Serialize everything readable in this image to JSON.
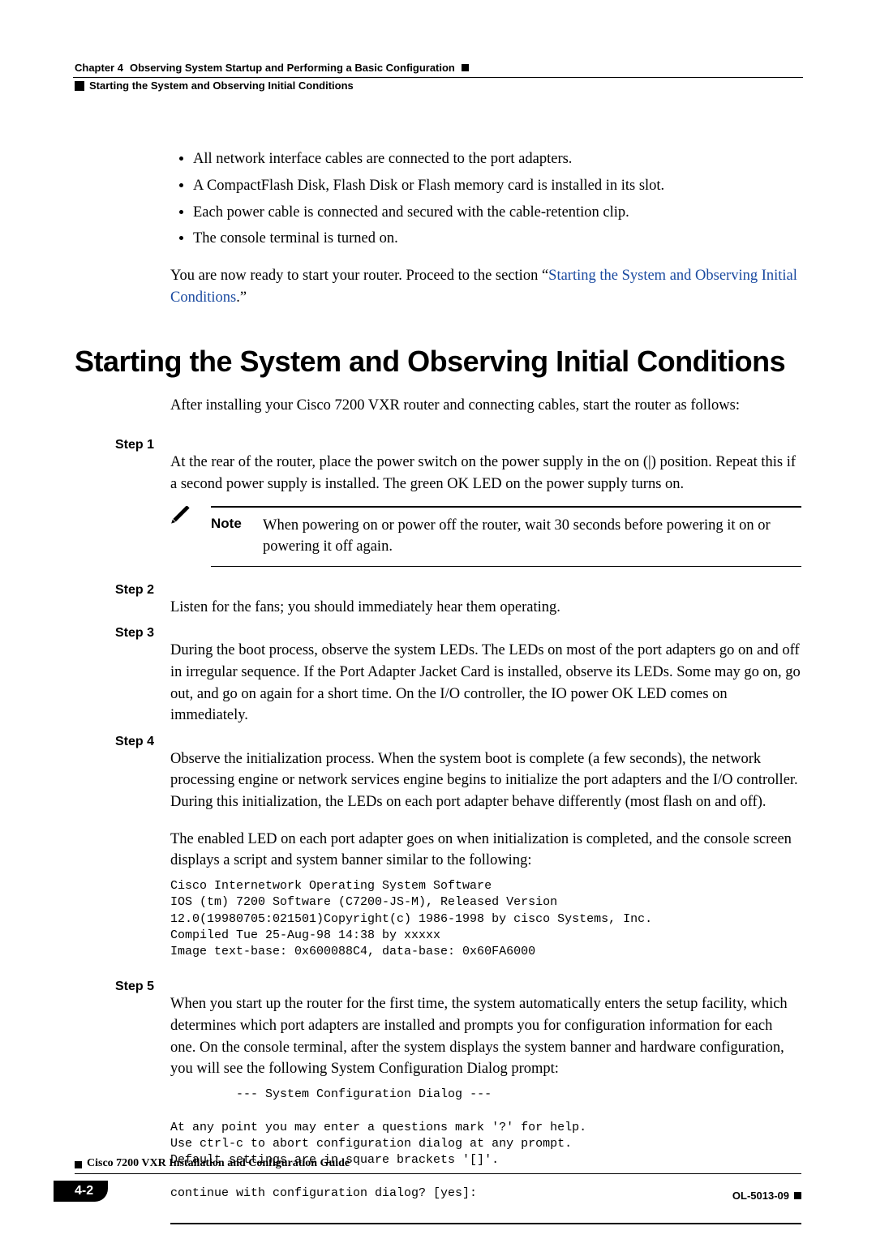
{
  "header": {
    "section_title": "Starting the System and Observing Initial Conditions",
    "chapter_label": "Chapter 4",
    "chapter_title": "Observing System Startup and Performing a Basic Configuration"
  },
  "intro": {
    "bullets": [
      "All network interface cables are connected to the port adapters.",
      "A CompactFlash Disk, Flash Disk or Flash memory card is installed in its slot.",
      "Each power cable is connected and secured with the cable-retention clip.",
      "The console terminal is turned on."
    ],
    "lead_text": "You are now ready to start your router. Proceed to the section “",
    "lead_link": "Starting the System and Observing Initial Conditions",
    "lead_tail": ".”"
  },
  "section": {
    "title": "Starting the System and Observing Initial Conditions",
    "intro": "After installing your Cisco 7200 VXR router and connecting cables, start the router as follows:"
  },
  "steps": {
    "s1_label": "Step 1",
    "s1_text": "At the rear of the router, place the power switch on the power supply in the on (|) position. Repeat this if a second power supply is installed. The green OK LED on the power supply turns on.",
    "note_label": "Note",
    "note_text": "When powering on or power off the router, wait 30 seconds before powering it on or powering it off again.",
    "s2_label": "Step 2",
    "s2_text": "Listen for the fans; you should immediately hear them operating.",
    "s3_label": "Step 3",
    "s3_text": "During the boot process, observe the system LEDs. The LEDs on most of the port adapters go on and off in irregular sequence. If the Port Adapter Jacket Card is installed, observe its LEDs. Some may go on, go out, and go on again for a short time. On the I/O controller, the IO power OK LED comes on immediately.",
    "s4_label": "Step 4",
    "s4_text1": "Observe the initialization process. When the system boot is complete (a few seconds), the network processing engine or network services engine begins to initialize the port adapters and the I/O controller. During this initialization, the LEDs on each port adapter behave differently (most flash on and off).",
    "s4_text2": "The enabled LED on each port adapter goes on when initialization is completed, and the console screen displays a script and system banner similar to the following:",
    "s4_code": "Cisco Internetwork Operating System Software\nIOS (tm) 7200 Software (C7200-JS-M), Released Version 12.0(19980705:021501)Copyright(c) 1986-1998 by cisco Systems, Inc.\nCompiled Tue 25-Aug-98 14:38 by xxxxx\nImage text-base: 0x600088C4, data-base: 0x60FA6000",
    "s5_label": "Step 5",
    "s5_text": "When you start up the router for the first time, the system automatically enters the setup facility, which determines which port adapters are installed and prompts you for configuration information for each one. On the console terminal, after the system displays the system banner and hardware configuration, you will see the following System Configuration Dialog prompt:",
    "s5_code": "         --- System Configuration Dialog ---\n\nAt any point you may enter a questions mark '?' for help.\nUse ctrl-c to abort configuration dialog at any prompt.\nDefault settings are in square brackets '[]'.\n\ncontinue with configuration dialog? [yes]:"
  },
  "footer": {
    "guide_title": "Cisco 7200 VXR Installation and Configuration Guide",
    "page_num": "4-2",
    "doc_num": "OL-5013-09"
  }
}
